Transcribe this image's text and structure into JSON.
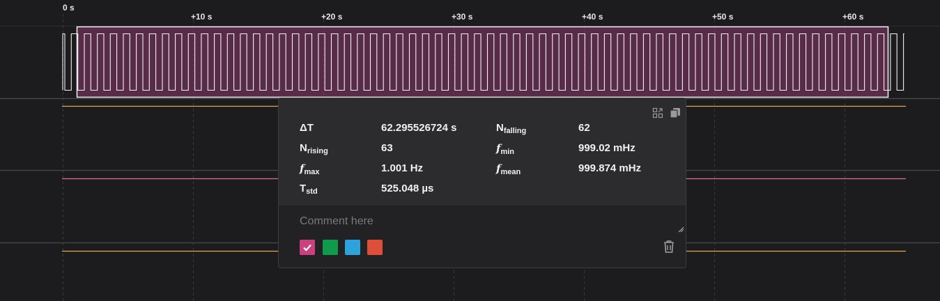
{
  "timeline": {
    "ticks": [
      {
        "label": "0 s"
      },
      {
        "label": "+10 s"
      },
      {
        "label": "+20 s"
      },
      {
        "label": "+30 s"
      },
      {
        "label": "+40 s"
      },
      {
        "label": "+50 s"
      },
      {
        "label": "+60 s"
      }
    ]
  },
  "channels": [
    {
      "color": "#ffffff",
      "type": "clock"
    },
    {
      "color": "#e3a35a"
    },
    {
      "color": "#e46f8a"
    },
    {
      "color": "#e8a640"
    }
  ],
  "selection": {
    "color": "#8b3a6b"
  },
  "measurement": {
    "delta_t": {
      "label": "ΔT",
      "value": "62.295526724 s"
    },
    "n_falling": {
      "label": "N",
      "sub": "falling",
      "value": "62"
    },
    "n_rising": {
      "label": "N",
      "sub": "rising",
      "value": "63"
    },
    "f_min": {
      "label": "f",
      "sub": "min",
      "value": "999.02 mHz"
    },
    "f_max": {
      "label": "f",
      "sub": "max",
      "value": "1.001 Hz"
    },
    "f_mean": {
      "label": "f",
      "sub": "mean",
      "value": "999.874 mHz"
    },
    "t_std": {
      "label": "T",
      "sub": "std",
      "value": "525.048 µs"
    }
  },
  "comment": {
    "placeholder": "Comment here",
    "value": ""
  },
  "swatches": [
    {
      "name": "magenta",
      "color": "#c9427f",
      "selected": true
    },
    {
      "name": "green",
      "color": "#109b4c",
      "selected": false
    },
    {
      "name": "blue",
      "color": "#2ea2dc",
      "selected": false
    },
    {
      "name": "red",
      "color": "#de4f3a",
      "selected": false
    }
  ],
  "icons": [
    "split-view-icon",
    "copy-icon",
    "check-icon",
    "trash-icon",
    "resize-grip-icon"
  ]
}
